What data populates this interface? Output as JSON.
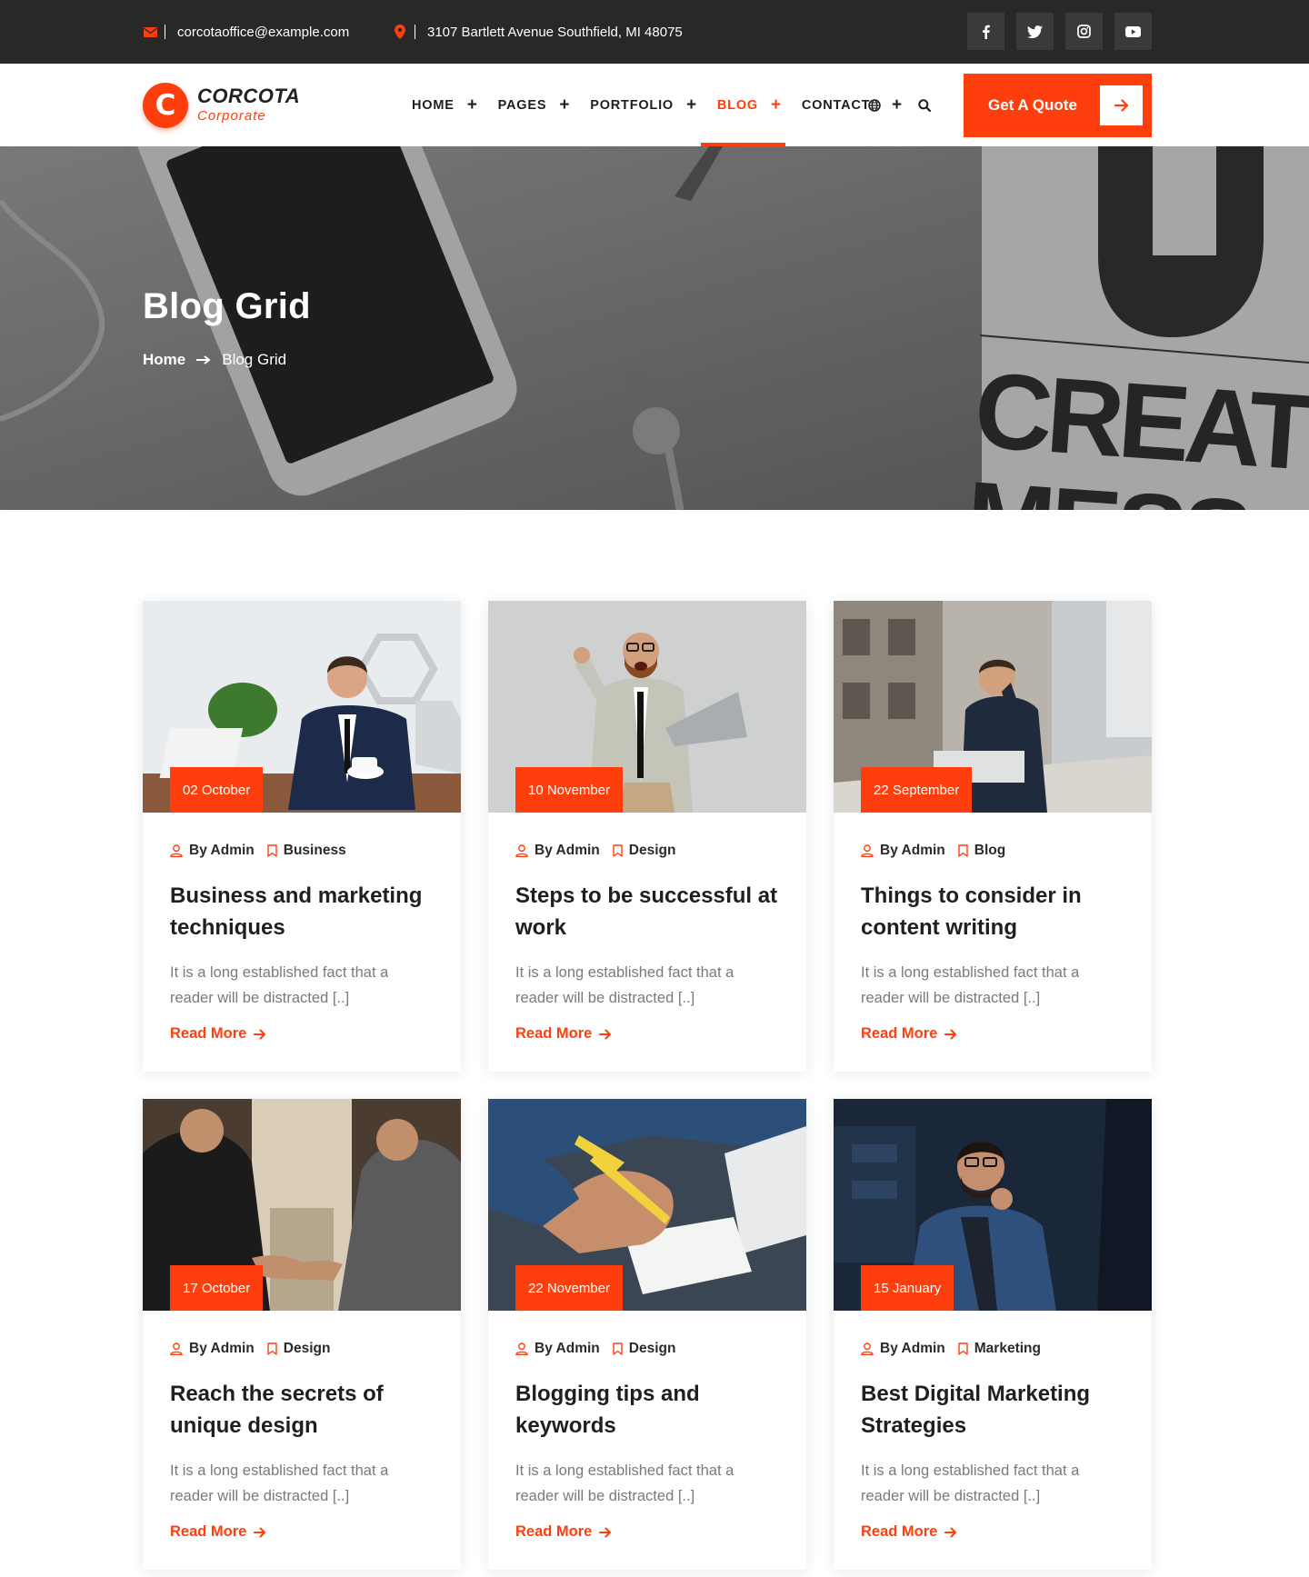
{
  "topbar": {
    "email": "corcotaoffice@example.com",
    "address": "3107 Bartlett Avenue Southfield, MI 48075",
    "social": [
      "facebook-icon",
      "twitter-icon",
      "instagram-icon",
      "youtube-icon"
    ]
  },
  "header": {
    "logo_initial": "C",
    "logo_name": "CORCOTA",
    "logo_tagline": "Corporate",
    "nav": [
      {
        "label": "HOME",
        "has_children": true
      },
      {
        "label": "PAGES",
        "has_children": true
      },
      {
        "label": "PORTFOLIO",
        "has_children": true
      },
      {
        "label": "BLOG",
        "has_children": true,
        "active": true
      },
      {
        "label": "CONTACT",
        "has_children": false
      }
    ],
    "plus_symbol": "+",
    "quote_button": "Get A Quote"
  },
  "hero": {
    "title": "Blog Grid",
    "breadcrumb_home": "Home",
    "breadcrumb_current": "Blog Grid"
  },
  "posts": [
    {
      "date": "02 October",
      "author": "By Admin",
      "category": "Business",
      "title": "Business and marketing techniques",
      "excerpt": "It is a long established fact that a reader will be distracted [..]",
      "read_more": "Read More"
    },
    {
      "date": "10 November",
      "author": "By Admin",
      "category": "Design",
      "title": "Steps to be successful at work",
      "excerpt": "It is a long established fact that a reader will be distracted [..]",
      "read_more": "Read More"
    },
    {
      "date": "22 September",
      "author": "By Admin",
      "category": "Blog",
      "title": "Things to consider in content writing",
      "excerpt": "It is a long established fact that a reader will be distracted [..]",
      "read_more": "Read More"
    },
    {
      "date": "17 October",
      "author": "By Admin",
      "category": "Design",
      "title": "Reach the secrets of unique design",
      "excerpt": "It is a long established fact that a reader will be distracted [..]",
      "read_more": "Read More"
    },
    {
      "date": "22 November",
      "author": "By Admin",
      "category": "Design",
      "title": "Blogging tips and keywords",
      "excerpt": "It is a long established fact that a reader will be distracted [..]",
      "read_more": "Read More"
    },
    {
      "date": "15 January",
      "author": "By Admin",
      "category": "Marketing",
      "title": "Best Digital Marketing Strategies",
      "excerpt": "It is a long established fact that a reader will be distracted [..]",
      "read_more": "Read More"
    }
  ],
  "colors": {
    "accent": "#ff3e0d",
    "topbar_bg": "#282828",
    "heading": "#1f1f1f",
    "body_text": "#7a7a7a"
  }
}
